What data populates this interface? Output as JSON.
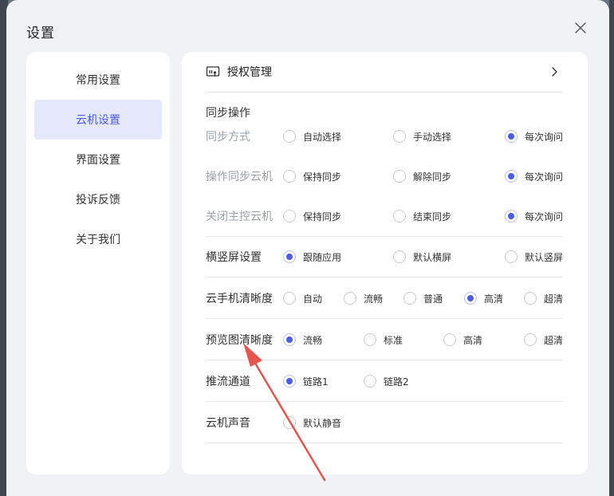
{
  "modal": {
    "title": "设置"
  },
  "sidebar": {
    "items": [
      {
        "label": "常用设置",
        "active": false
      },
      {
        "label": "云机设置",
        "active": true
      },
      {
        "label": "界面设置",
        "active": false
      },
      {
        "label": "投诉反馈",
        "active": false
      },
      {
        "label": "关于我们",
        "active": false
      }
    ]
  },
  "content": {
    "auth": {
      "label": "授权管理"
    },
    "sync_section": {
      "title": "同步操作"
    },
    "rows": [
      {
        "label": "同步方式",
        "muted": true,
        "options": [
          {
            "label": "自动选择",
            "selected": false
          },
          {
            "label": "手动选择",
            "selected": false
          },
          {
            "label": "每次询问",
            "selected": true
          }
        ]
      },
      {
        "label": "操作同步云机",
        "muted": true,
        "options": [
          {
            "label": "保持同步",
            "selected": false
          },
          {
            "label": "解除同步",
            "selected": false
          },
          {
            "label": "每次询问",
            "selected": true
          }
        ]
      },
      {
        "label": "关闭主控云机",
        "muted": true,
        "options": [
          {
            "label": "保持同步",
            "selected": false
          },
          {
            "label": "结束同步",
            "selected": false
          },
          {
            "label": "每次询问",
            "selected": true
          }
        ]
      },
      {
        "label": "横竖屏设置",
        "muted": false,
        "options": [
          {
            "label": "跟随应用",
            "selected": true
          },
          {
            "label": "默认横屏",
            "selected": false
          },
          {
            "label": "默认竖屏",
            "selected": false
          }
        ]
      },
      {
        "label": "云手机清晰度",
        "muted": false,
        "options": [
          {
            "label": "自动",
            "selected": false
          },
          {
            "label": "流畅",
            "selected": false
          },
          {
            "label": "普通",
            "selected": false
          },
          {
            "label": "高清",
            "selected": true
          },
          {
            "label": "超清",
            "selected": false
          }
        ]
      },
      {
        "label": "预览图清晰度",
        "muted": false,
        "options": [
          {
            "label": "流畅",
            "selected": true
          },
          {
            "label": "标准",
            "selected": false
          },
          {
            "label": "高清",
            "selected": false
          },
          {
            "label": "超清",
            "selected": false
          }
        ]
      },
      {
        "label": "推流通道",
        "muted": false,
        "options": [
          {
            "label": "链路1",
            "selected": true
          },
          {
            "label": "链路2",
            "selected": false
          }
        ]
      },
      {
        "label": "云机声音",
        "muted": false,
        "options": [
          {
            "label": "默认静音",
            "selected": false
          }
        ]
      }
    ]
  },
  "colors": {
    "accent": "#4b5ce6",
    "active_bg": "#e6e9fb",
    "annotation_arrow": "#e8554e"
  },
  "icons": {
    "close": "close-icon",
    "auth": "license-icon",
    "chevron": "chevron-right-icon"
  }
}
